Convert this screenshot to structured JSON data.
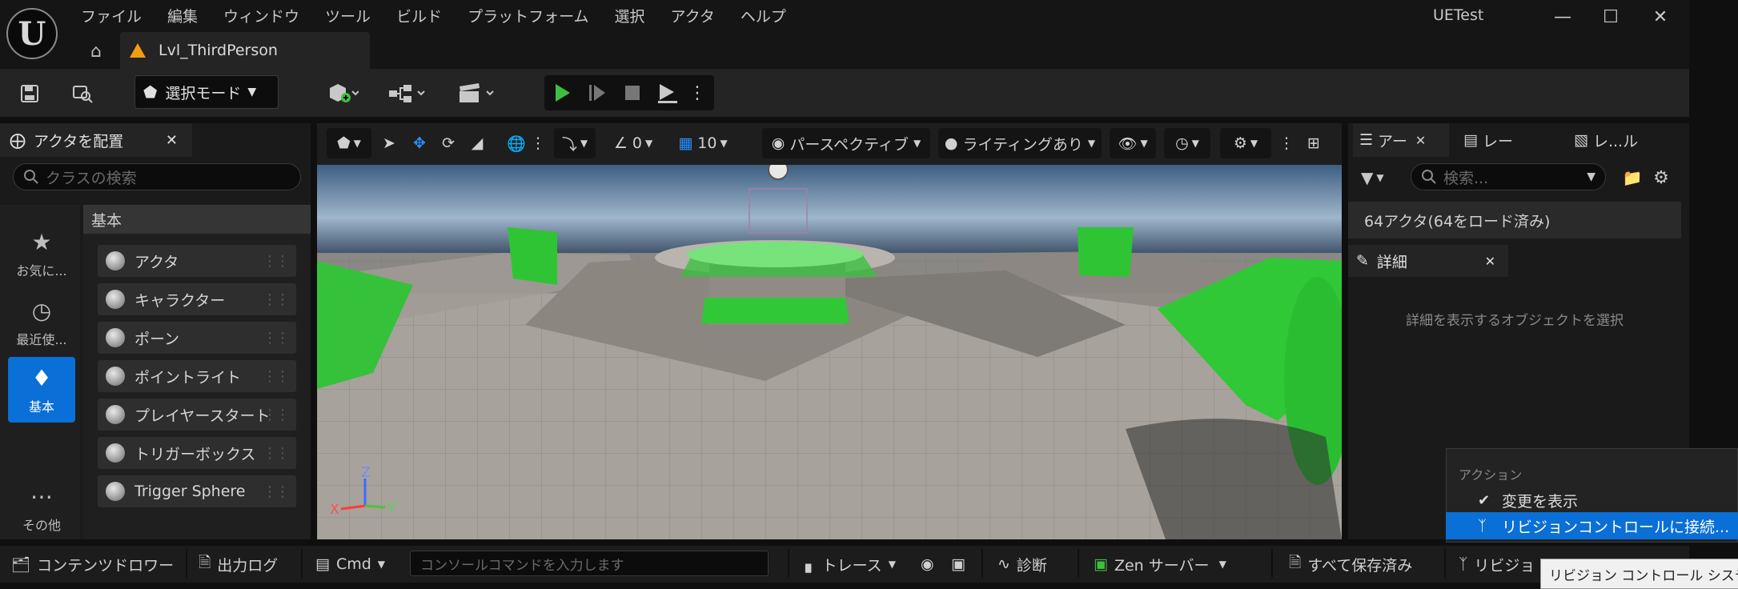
{
  "app": {
    "window_title": "UETest",
    "level_tab": "Lvl_ThirdPerson"
  },
  "menu": [
    "ファイル",
    "編集",
    "ウィンドウ",
    "ツール",
    "ビルド",
    "プラットフォーム",
    "選択",
    "アクタ",
    "ヘルプ"
  ],
  "toolbar": {
    "select_mode": "選択モード"
  },
  "place_actors": {
    "tab_label": "アクタを配置",
    "search_placeholder": "クラスの検索",
    "categories": [
      {
        "label": "お気に...",
        "icon": "star-icon"
      },
      {
        "label": "最近使...",
        "icon": "clock-icon"
      },
      {
        "label": "基本",
        "icon": "shapes-icon"
      },
      {
        "label": "その他",
        "icon": "more-icon"
      }
    ],
    "section_header": "基本",
    "items": [
      "アクタ",
      "キャラクター",
      "ポーン",
      "ポイントライト",
      "プレイヤースタート",
      "トリガーボックス",
      "Trigger Sphere"
    ]
  },
  "viewport": {
    "snap_rotation": "0",
    "grid_snap": "10",
    "perspective": "パースペクティブ",
    "lighting": "ライティングあり",
    "axis_x": "X",
    "axis_y": "Y",
    "axis_z": "Z"
  },
  "outliner": {
    "tabs": [
      "アー",
      "レー",
      "レ...ル"
    ],
    "search_placeholder": "検索...",
    "actor_count": "64アクタ(64をロード済み)"
  },
  "details": {
    "tab_label": "詳細",
    "empty_text": "詳細を表示するオブジェクトを選択"
  },
  "context_menu": {
    "header": "アクション",
    "items": [
      "変更を表示",
      "リビジョンコントロールに接続..."
    ]
  },
  "statusbar": {
    "content_drawer": "コンテンツドロワー",
    "output_log": "出力ログ",
    "cmd": "Cmd",
    "console_placeholder": "コンソールコマンドを入力します",
    "trace": "トレース",
    "diagnostics": "診断",
    "zen_server": "Zen サーバー",
    "all_saved": "すべて保存済み",
    "revision": "リビジョ",
    "tooltip": "リビジョン コントロール システ"
  },
  "colors": {
    "accent_blue": "#0a6fd6",
    "play_green": "#3fbf3f",
    "level_orange": "#f39c12",
    "geometry_green": "#33cc33"
  }
}
